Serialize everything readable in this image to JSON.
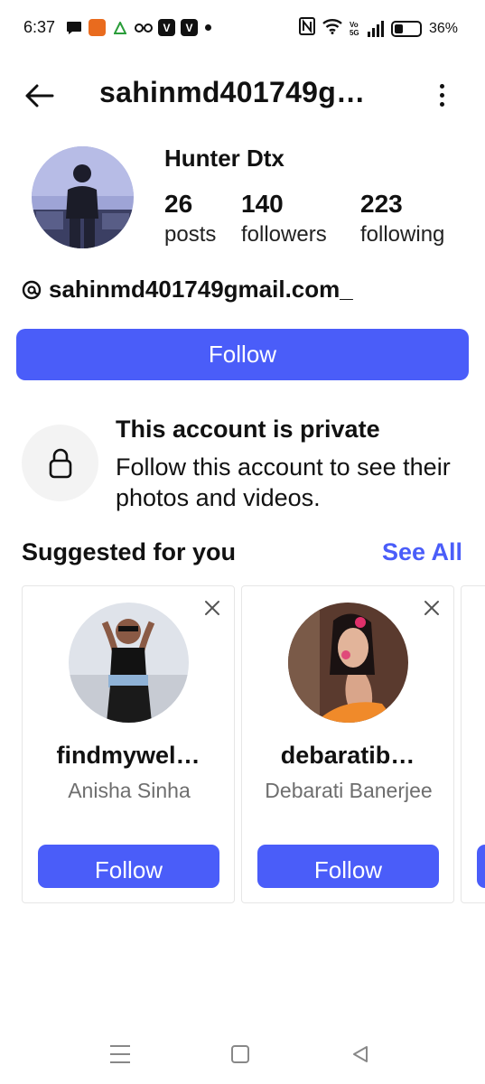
{
  "status_bar": {
    "time": "6:37",
    "battery_percent": "36%",
    "battery_level": 0.36,
    "signal_label": "Vo 5G",
    "left_icons": [
      "message-icon",
      "app-icon",
      "app-icon-2",
      "glasses-icon",
      "v-icon",
      "v-icon"
    ],
    "right_icons": [
      "nfc-icon",
      "wifi-icon",
      "signal-icon",
      "battery-icon"
    ]
  },
  "header": {
    "username": "sahinmd401749g…"
  },
  "profile": {
    "display_name": "Hunter Dtx",
    "posts_count": "26",
    "posts_label": "posts",
    "followers_count": "140",
    "followers_label": "followers",
    "following_count": "223",
    "following_label": "following",
    "threads_handle": "sahinmd401749gmail.com_"
  },
  "follow_button": "Follow",
  "private": {
    "title": "This account is private",
    "description": "Follow this account to see their photos and videos."
  },
  "suggested": {
    "title": "Suggested for you",
    "see_all": "See All",
    "cards": [
      {
        "username": "findmywel…",
        "name": "Anisha Sinha",
        "follow": "Follow"
      },
      {
        "username": "debaratib…",
        "name": "Debarati Banerjee",
        "follow": "Follow"
      }
    ]
  },
  "colors": {
    "accent": "#4a5df9",
    "text": "#111111",
    "muted": "#6e6e6e"
  }
}
